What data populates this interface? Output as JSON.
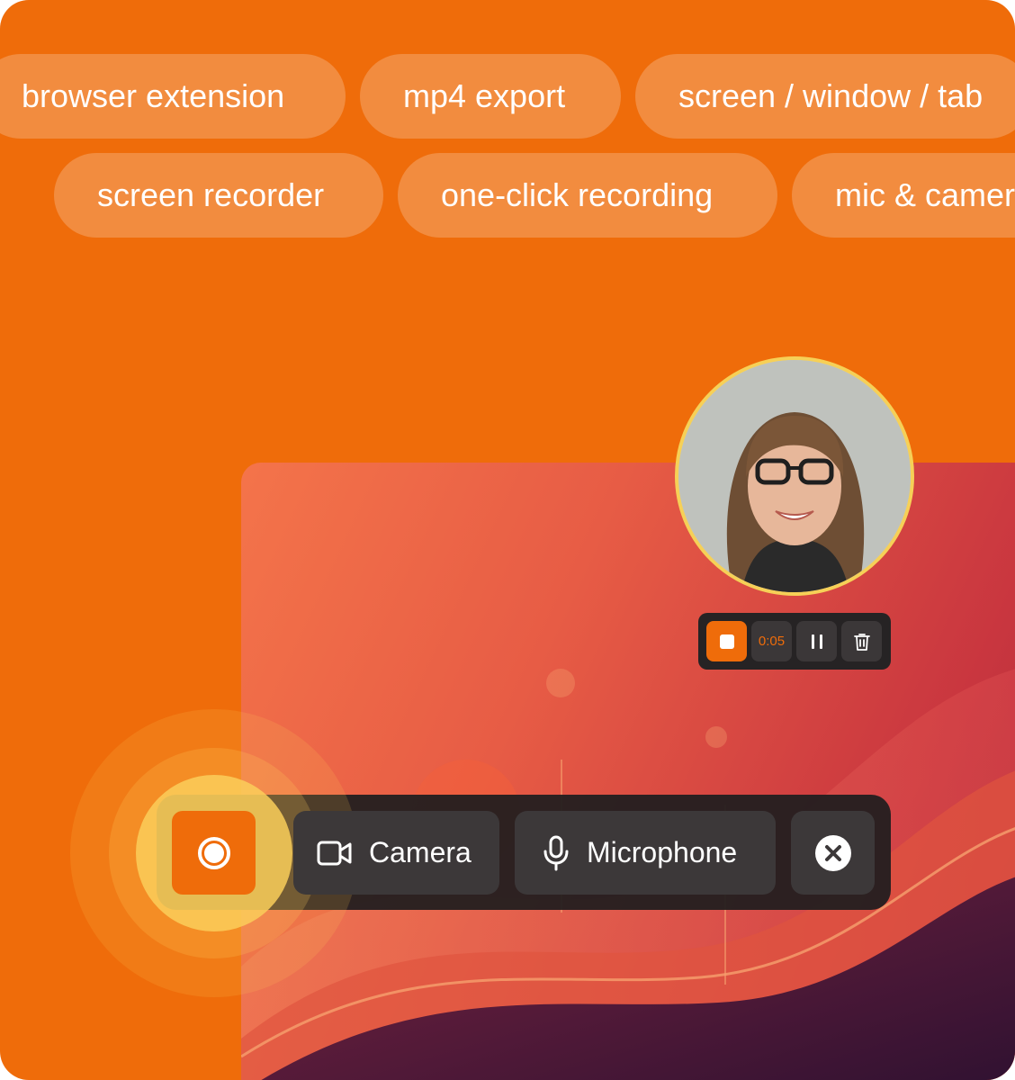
{
  "features": {
    "row1": [
      "browser extension",
      "mp4 export",
      "screen / window / tab"
    ],
    "row2": [
      "screen recorder",
      "one-click recording",
      "mic & camera"
    ]
  },
  "colors": {
    "brand": "#ef6c0a",
    "panel": "#262324",
    "button": "#3c3839",
    "highlight": "#f6d057"
  },
  "webcam": {
    "icon": "person-avatar"
  },
  "mini_controls": {
    "stop_icon": "stop-icon",
    "timer": "0:05",
    "pause_icon": "pause-icon",
    "delete_icon": "trash-icon"
  },
  "toolbar": {
    "record_icon": "record-icon",
    "camera_label": "Camera",
    "camera_icon": "video-camera-icon",
    "microphone_label": "Microphone",
    "microphone_icon": "microphone-icon",
    "close_icon": "close-icon"
  }
}
